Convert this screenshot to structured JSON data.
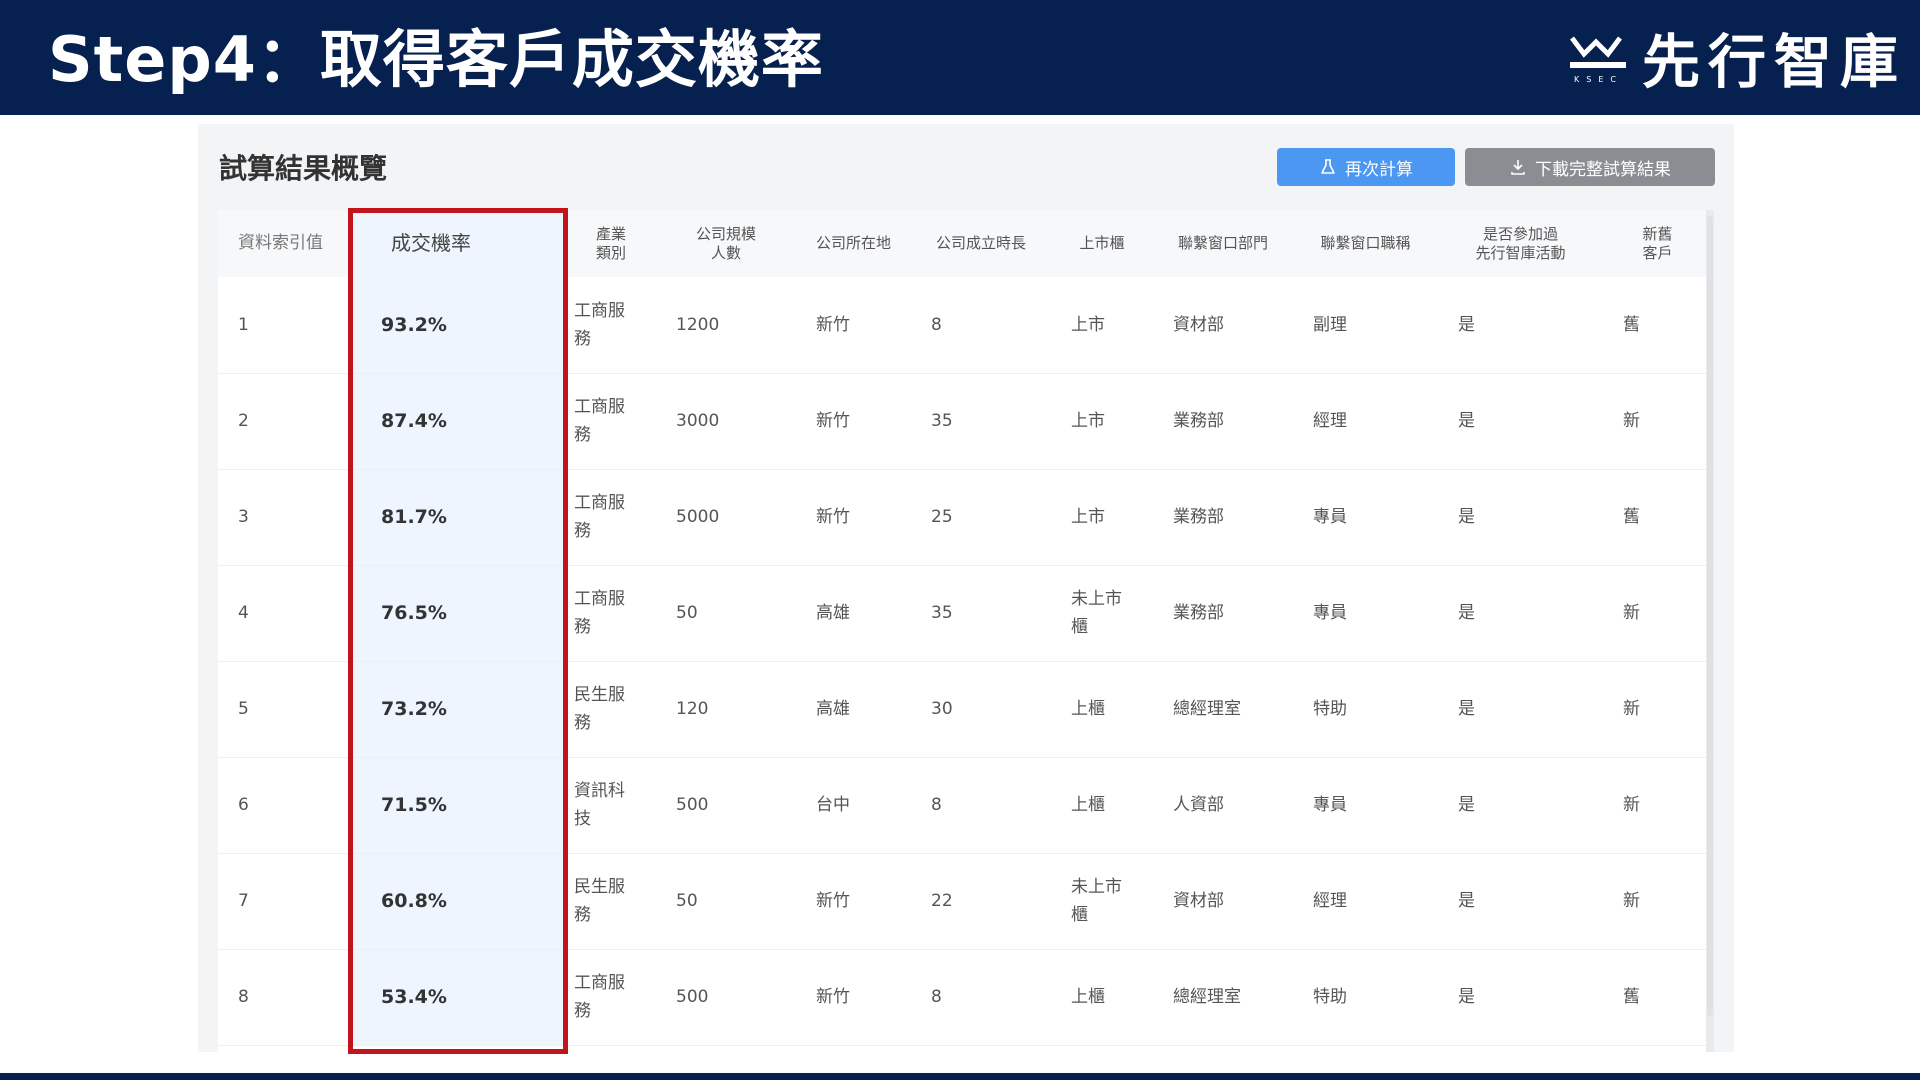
{
  "slide": {
    "title": "Step4：取得客戶成交機率",
    "brand_name": "先行智庫",
    "brand_sub": "KSEC",
    "accent_color": "#06214f",
    "highlight_color": "#c3141c"
  },
  "panel": {
    "title": "試算結果概覽",
    "recalc_label": "再次計算",
    "recalc_icon": "flask-icon",
    "download_label": "下載完整試算結果",
    "download_icon": "download-icon"
  },
  "table": {
    "headers": [
      "資料索引值",
      "成交機率",
      "產業\n類別",
      "公司規模\n人數",
      "公司所在地",
      "公司成立時長",
      "上市櫃",
      "聯繫窗口部門",
      "聯繫窗口職稱",
      "是否參加過\n先行智庫活動",
      "新舊\n客戶"
    ],
    "rows": [
      [
        "1",
        "93.2%",
        "工商服\n務",
        "1200",
        "新竹",
        "8",
        "上市",
        "資材部",
        "副理",
        "是",
        "舊"
      ],
      [
        "2",
        "87.4%",
        "工商服\n務",
        "3000",
        "新竹",
        "35",
        "上市",
        "業務部",
        "經理",
        "是",
        "新"
      ],
      [
        "3",
        "81.7%",
        "工商服\n務",
        "5000",
        "新竹",
        "25",
        "上市",
        "業務部",
        "專員",
        "是",
        "舊"
      ],
      [
        "4",
        "76.5%",
        "工商服\n務",
        "50",
        "高雄",
        "35",
        "未上市\n櫃",
        "業務部",
        "專員",
        "是",
        "新"
      ],
      [
        "5",
        "73.2%",
        "民生服\n務",
        "120",
        "高雄",
        "30",
        "上櫃",
        "總經理室",
        "特助",
        "是",
        "新"
      ],
      [
        "6",
        "71.5%",
        "資訊科\n技",
        "500",
        "台中",
        "8",
        "上櫃",
        "人資部",
        "專員",
        "是",
        "新"
      ],
      [
        "7",
        "60.8%",
        "民生服\n務",
        "50",
        "新竹",
        "22",
        "未上市\n櫃",
        "資材部",
        "經理",
        "是",
        "新"
      ],
      [
        "8",
        "53.4%",
        "工商服\n務",
        "500",
        "新竹",
        "8",
        "上櫃",
        "總經理室",
        "特助",
        "是",
        "舊"
      ]
    ]
  }
}
